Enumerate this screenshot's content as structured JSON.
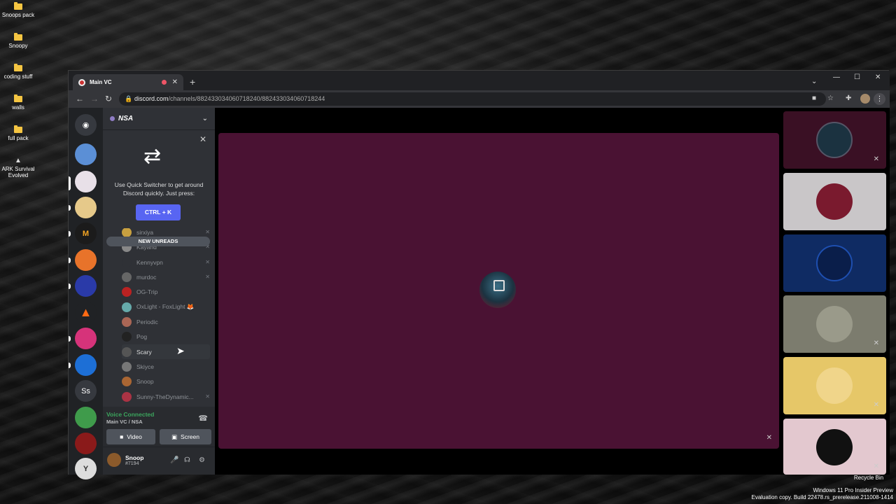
{
  "desktop": {
    "icons": [
      "Snoops pack",
      "Snoopy",
      "coding stuff",
      "walls",
      "full pack",
      "ARK Survival Evolved"
    ],
    "recycle_bin": "Recycle Bin",
    "watermark_line1": "Windows 11 Pro Insider Preview",
    "watermark_line2": "Evaluation copy. Build 22478.rs_prerelease.211008-1414"
  },
  "browser": {
    "tab_title": "Main VC",
    "url_host": "discord.com",
    "url_path": "/channels/882433034060718240/882433034060718244"
  },
  "discord": {
    "server_name": "NSA",
    "quick_switcher": {
      "text": "Use Quick Switcher to get around Discord quickly. Just press:",
      "shortcut": "CTRL + K"
    },
    "new_unreads": "NEW UNREADS",
    "members": [
      {
        "name": "sirxiya",
        "muted": true,
        "color": "#c8a040"
      },
      {
        "name": "Kayand",
        "muted": true,
        "color": "#888"
      },
      {
        "name": "Kennyvpn",
        "muted": true,
        "color": "#2f3136"
      },
      {
        "name": "murdoc",
        "muted": true,
        "color": "#666"
      },
      {
        "name": "OG-Trip",
        "muted": false,
        "color": "#b22"
      },
      {
        "name": "OxLight - FoxLight 🦊",
        "muted": false,
        "color": "#6aa"
      },
      {
        "name": "Periodic",
        "muted": false,
        "color": "#a65"
      },
      {
        "name": "Pog",
        "muted": false,
        "color": "#222"
      },
      {
        "name": "Scary",
        "muted": false,
        "color": "#555"
      },
      {
        "name": "Skiyce",
        "muted": false,
        "color": "#777"
      },
      {
        "name": "Snoop",
        "muted": false,
        "color": "#a63"
      },
      {
        "name": "Sunny-TheDynamic...",
        "muted": true,
        "color": "#a34"
      }
    ],
    "voice": {
      "status": "Voice Connected",
      "channel": "Main VC / NSA",
      "video_label": "Video",
      "screen_label": "Screen"
    },
    "user": {
      "name": "Snoop",
      "tag": "#7194"
    },
    "guild_initials": "Ss"
  }
}
